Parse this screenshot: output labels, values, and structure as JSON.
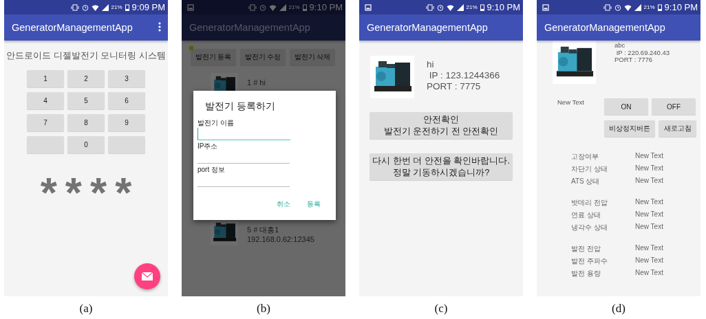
{
  "panels": [
    {
      "kind": "pin",
      "caption": "(a)",
      "status": {
        "screenshot_icon": false,
        "battery": "21%",
        "time": "9:09 PM"
      },
      "app_bar": {
        "title": "GeneratorManagementApp",
        "menu": true
      },
      "heading": "안드로이드 디젤발전기 모니터링 시스템",
      "keys": [
        {
          "kind": "digit",
          "label": "1"
        },
        {
          "kind": "digit",
          "label": "2"
        },
        {
          "kind": "digit",
          "label": "3"
        },
        {
          "kind": "digit",
          "label": "4"
        },
        {
          "kind": "digit",
          "label": "5"
        },
        {
          "kind": "digit",
          "label": "6"
        },
        {
          "kind": "digit",
          "label": "7"
        },
        {
          "kind": "digit",
          "label": "8"
        },
        {
          "kind": "digit",
          "label": "9"
        },
        {
          "kind": "blank"
        },
        {
          "kind": "digit",
          "label": "0"
        },
        {
          "kind": "blank"
        }
      ],
      "pin_mask": [
        "*",
        "*",
        "*",
        "*"
      ],
      "fab": true
    },
    {
      "kind": "list",
      "caption": "(b)",
      "status": {
        "screenshot_icon": true,
        "battery": "21%",
        "time": "9:10 PM"
      },
      "app_bar": {
        "title": "GeneratorManagementApp",
        "menu": false
      },
      "buttons": [
        "발전기 등록",
        "발전기 수정",
        "발전기 삭제"
      ],
      "items": [
        {
          "lines": [
            "1 # hi"
          ]
        },
        {
          "lines": [
            "5 # 대흥1",
            "192.168.0.62:12345"
          ]
        }
      ],
      "dialog": {
        "title": "발전기 등록하기",
        "fields": [
          {
            "label": "발전기 이름",
            "focused": true
          },
          {
            "label": "IP주소",
            "focused": false
          },
          {
            "label": "port 정보",
            "focused": false
          }
        ],
        "actions": [
          "취소",
          "등록"
        ]
      }
    },
    {
      "kind": "confirm",
      "caption": "(c)",
      "status": {
        "screenshot_icon": true,
        "battery": "21%",
        "time": "9:10 PM"
      },
      "app_bar": {
        "title": "GeneratorManagementApp",
        "menu": false
      },
      "device": {
        "name": "hi",
        "ip": " IP : 123.1244366",
        "port": "PORT : 7775"
      },
      "buttons": [
        {
          "lines": [
            "안전확인",
            "발전기 운전하기 전 안전확인"
          ]
        },
        {
          "lines": [
            "다시 한번 더 안전을 확인바랍니다.",
            "정말 기동하시겠습니까?"
          ]
        }
      ]
    },
    {
      "kind": "monitor",
      "caption": "(d)",
      "status": {
        "screenshot_icon": true,
        "battery": "21%",
        "time": "9:10 PM"
      },
      "app_bar": {
        "title": "GeneratorManagementApp",
        "menu": false
      },
      "device": {
        "name": "abc",
        "ip": " IP : 220.69.240.43",
        "port": "PORT : 7776"
      },
      "state_text": "New Text",
      "controls": [
        "ON",
        "OFF",
        "비상정지버튼",
        "새로고침"
      ],
      "groups": [
        [
          {
            "label": "고장여부",
            "value": "New Text"
          },
          {
            "label": "차단기 상태",
            "value": "New Text"
          },
          {
            "label": "ATS 상태",
            "value": "New Text"
          }
        ],
        [
          {
            "label": "밧데리 전압",
            "value": "New Text"
          },
          {
            "label": "연료 상태",
            "value": "New Text"
          },
          {
            "label": "냉각수 상태",
            "value": "New Text"
          }
        ],
        [
          {
            "label": "발전 전압",
            "value": "New Text"
          },
          {
            "label": "발전 주파수",
            "value": "New Text"
          },
          {
            "label": "발전 용량",
            "value": "New Text"
          }
        ]
      ]
    }
  ]
}
